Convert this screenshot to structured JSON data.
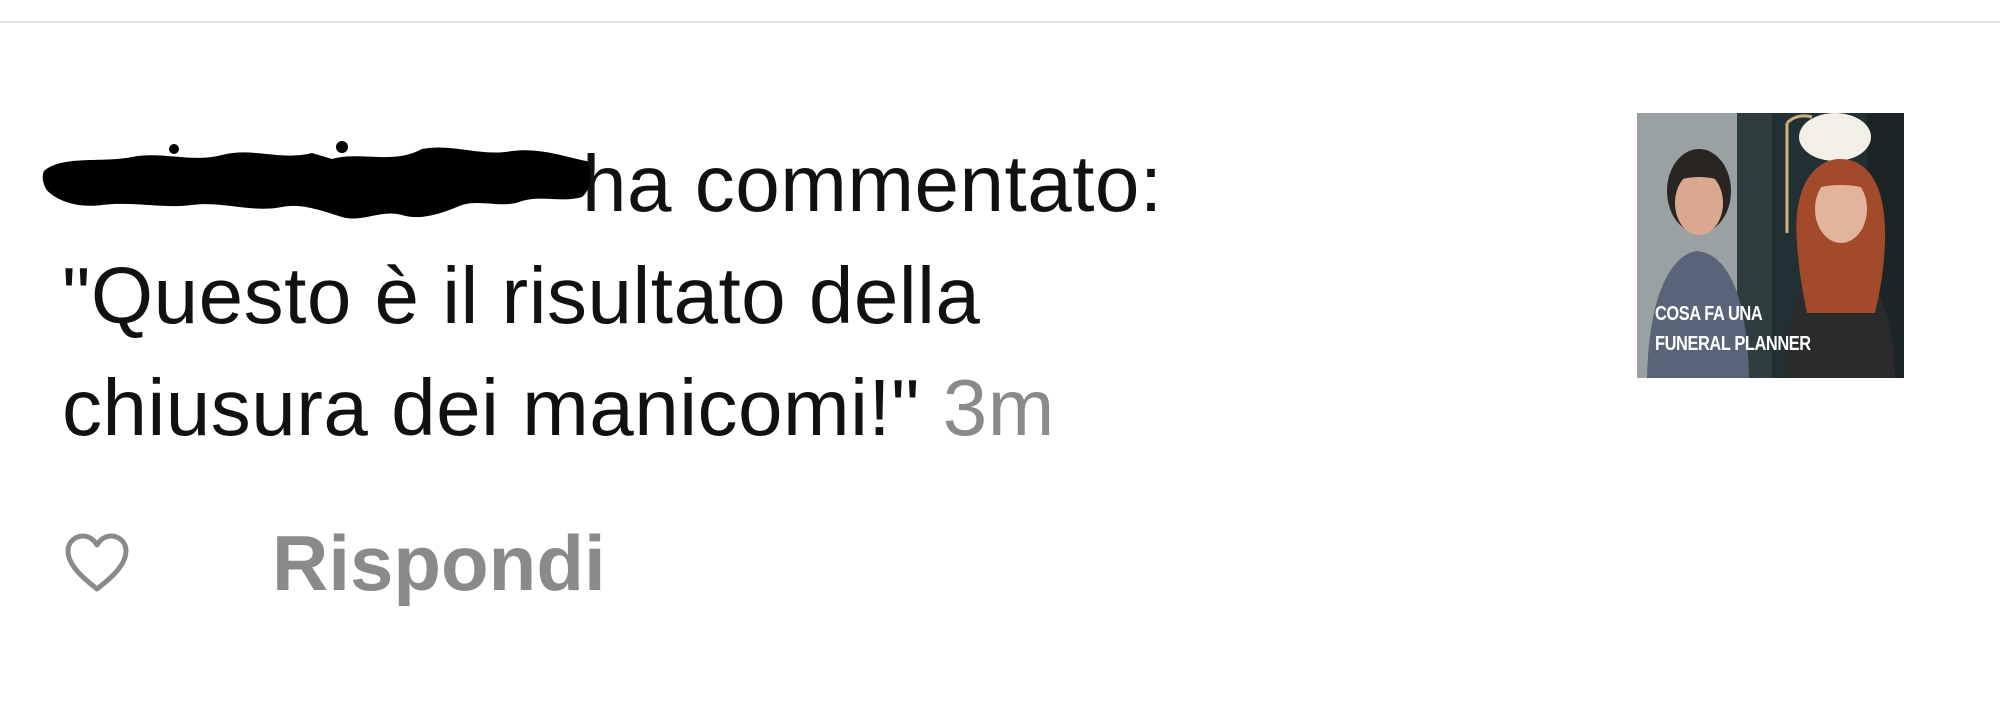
{
  "notification": {
    "action_text": "ha commentato:",
    "comment_lines": [
      "\"Questo è il risultato della",
      "chiusura dei manicomi!\""
    ],
    "timestamp": "3m",
    "reply_label": "Rispondi",
    "like_icon": "heart-outline-icon"
  },
  "thumbnail": {
    "caption_lines": [
      "COSA FA UNA",
      "FUNERAL PLANNER"
    ]
  },
  "colors": {
    "text": "#111111",
    "secondary_text": "#8a8a8a",
    "divider": "#e4e4e4",
    "background": "#ffffff"
  }
}
